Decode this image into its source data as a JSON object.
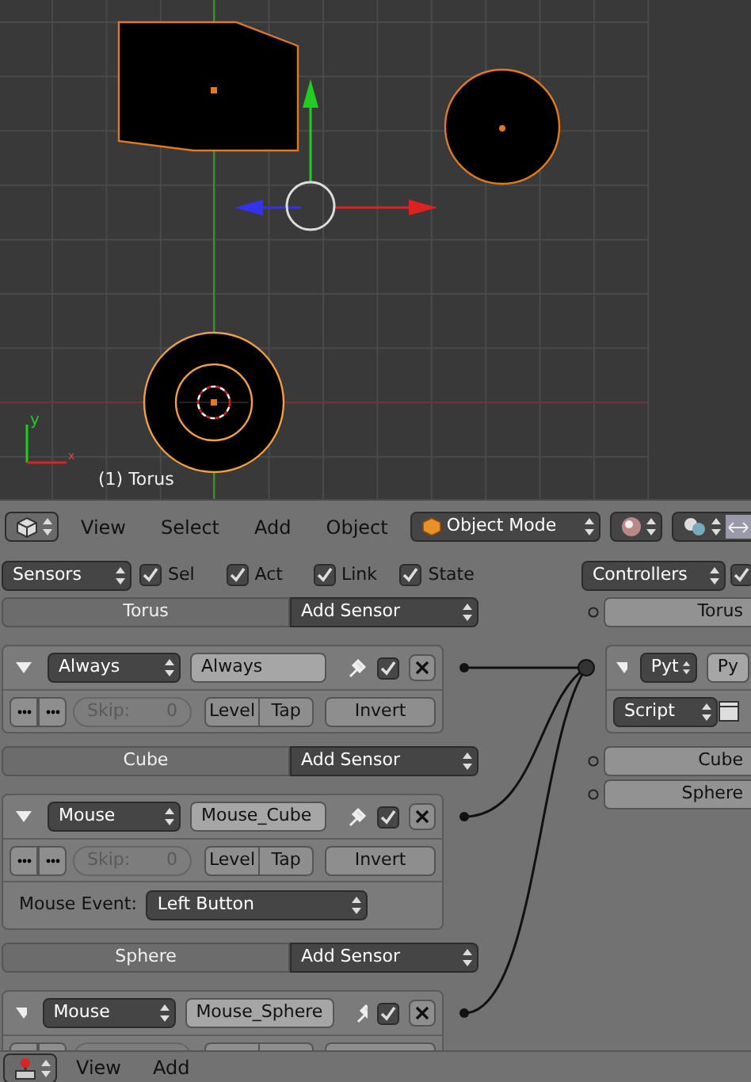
{
  "viewport": {
    "object_label": "(1) Torus",
    "axis_labels": [
      "y",
      "x"
    ]
  },
  "header": {
    "menus": [
      "View",
      "Select",
      "Add",
      "Object"
    ],
    "mode": "Object Mode"
  },
  "sensors": {
    "filter": "Sensors",
    "toggles": [
      {
        "label": "Sel",
        "checked": true
      },
      {
        "label": "Act",
        "checked": true
      },
      {
        "label": "Link",
        "checked": true
      },
      {
        "label": "State",
        "checked": true
      }
    ],
    "objects": [
      {
        "name": "Torus",
        "add_label": "Add Sensor",
        "sensors": [
          {
            "type": "Always",
            "name": "Always",
            "active": true,
            "linked": true,
            "skip_label": "Skip:",
            "skip": "0",
            "level": "Level",
            "tap": "Tap",
            "invert": "Invert"
          }
        ]
      },
      {
        "name": "Cube",
        "add_label": "Add Sensor",
        "sensors": [
          {
            "type": "Mouse",
            "name": "Mouse_Cube",
            "active": true,
            "linked": true,
            "skip_label": "Skip:",
            "skip": "0",
            "level": "Level",
            "tap": "Tap",
            "invert": "Invert",
            "event_label": "Mouse Event:",
            "event": "Left Button"
          }
        ]
      },
      {
        "name": "Sphere",
        "add_label": "Add Sensor",
        "sensors": [
          {
            "type": "Mouse",
            "name": "Mouse_Sphere",
            "active": true,
            "linked": true
          }
        ]
      }
    ]
  },
  "controllers": {
    "filter": "Controllers",
    "checked": true,
    "objects": [
      {
        "name": "Torus",
        "controllers": [
          {
            "type": "Pyt",
            "name": "Py",
            "mode": "Script"
          }
        ]
      },
      {
        "name": "Cube"
      },
      {
        "name": "Sphere"
      }
    ]
  },
  "footer": {
    "menus": [
      "View",
      "Add"
    ]
  }
}
